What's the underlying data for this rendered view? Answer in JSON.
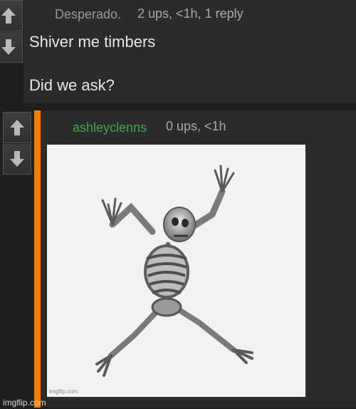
{
  "comment1": {
    "author": "Desperado.",
    "meta": "2 ups, <1h, 1 reply",
    "lines": [
      "Shiver me timbers",
      "Did we ask?"
    ]
  },
  "comment2": {
    "author": "ashleyclenns",
    "meta": "0 ups, <1h",
    "image_alt": "Dancing skeleton image",
    "image_watermark": "imgflip.com"
  },
  "site_watermark": "imgflip.com",
  "icons": {
    "upvote": "arrow-up-icon",
    "downvote": "arrow-down-icon"
  },
  "colors": {
    "accent_orange": "#f07c0a",
    "username_green": "#3fa64a",
    "background": "#1f1f1f",
    "panel": "#2b2b2b"
  }
}
